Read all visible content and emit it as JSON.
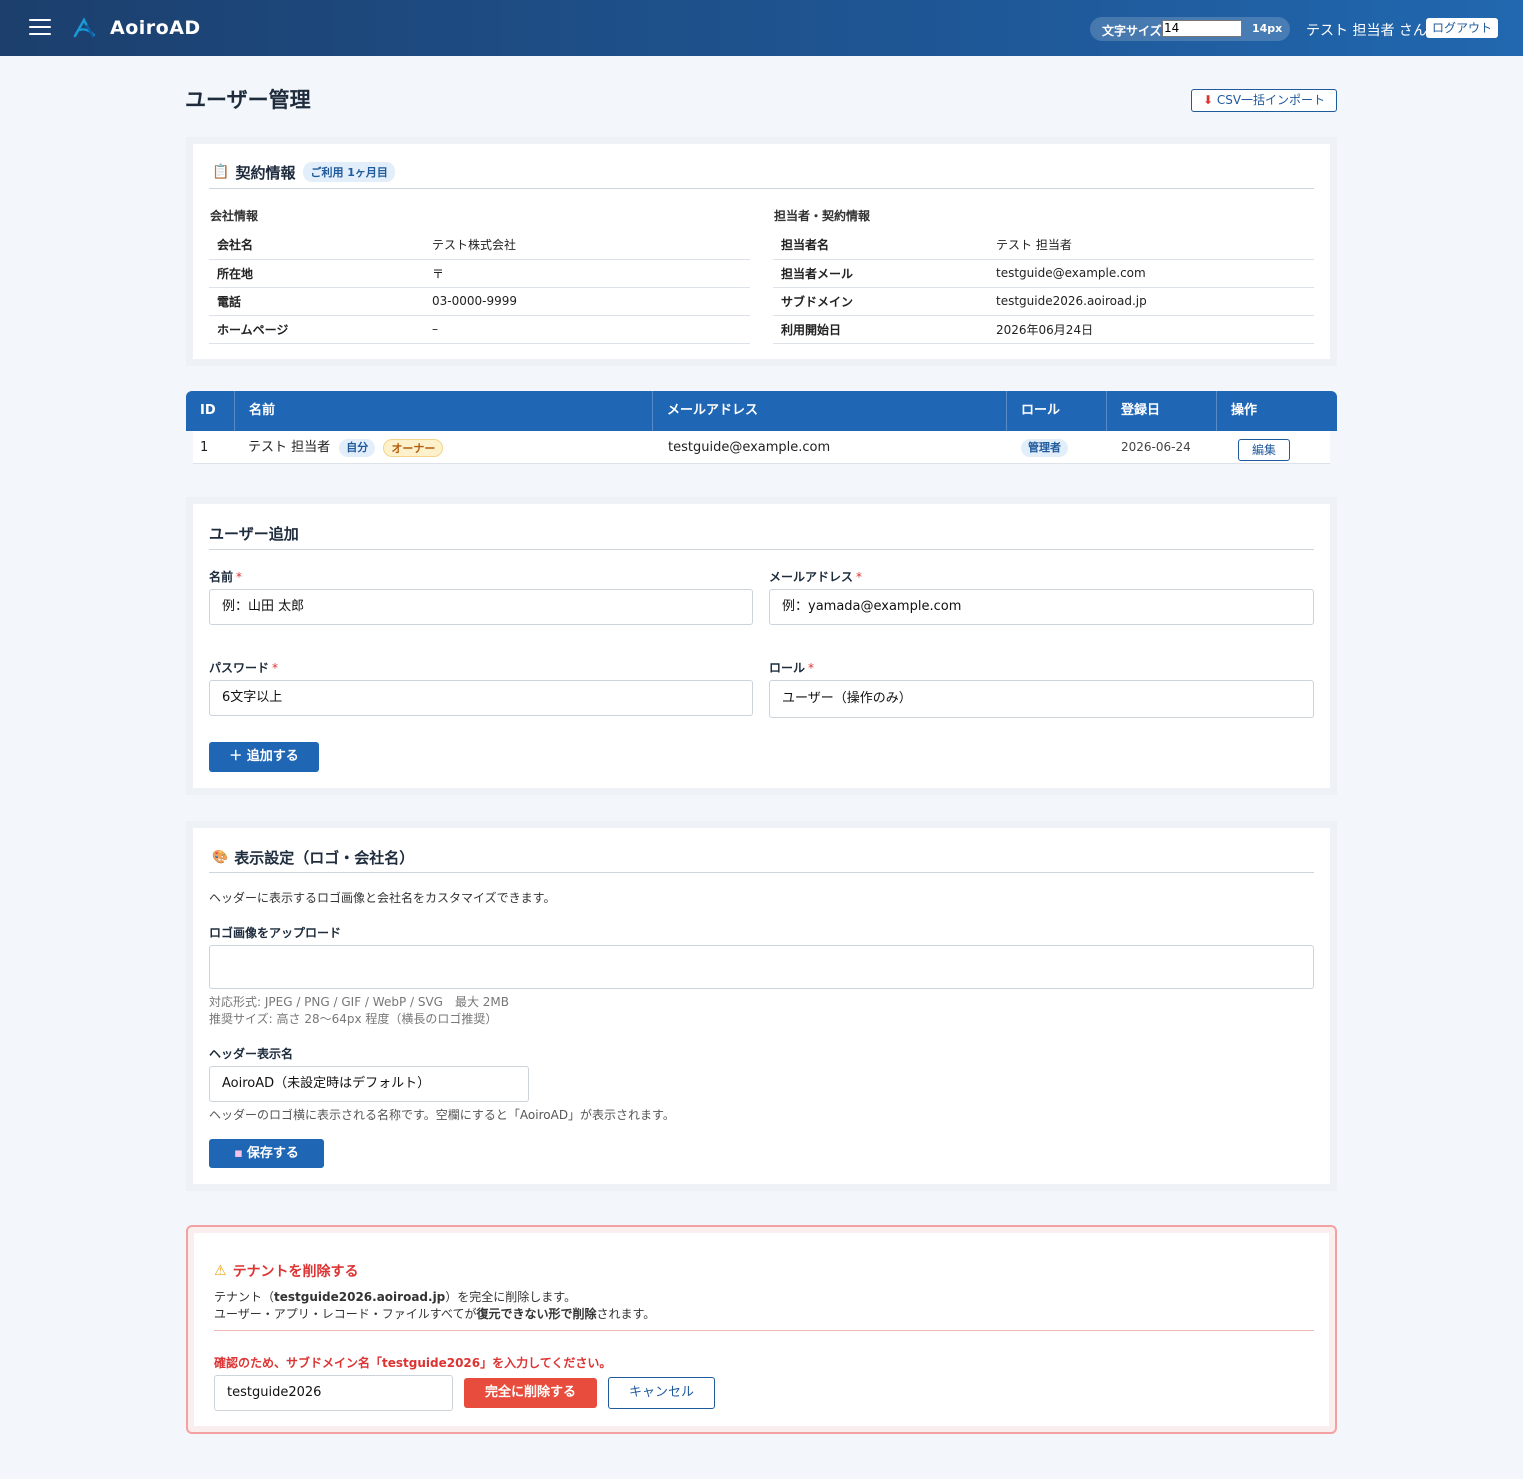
{
  "header": {
    "brand": "AoiroAD",
    "font_size_label": "文字サイズ",
    "font_size_input": "14",
    "font_size_value": "14px",
    "user_name": "テスト 担当者 さん",
    "logout": "ログアウト"
  },
  "page": {
    "title": "ユーザー管理",
    "csv_import": "CSV一括インポート"
  },
  "contract": {
    "title": "契約情報",
    "badge": "ご利用 1ヶ月目",
    "company_heading": "会社情報",
    "company": [
      {
        "key": "会社名",
        "value": "テスト株式会社"
      },
      {
        "key": "所在地",
        "value": "〒"
      },
      {
        "key": "電話",
        "value": "03-0000-9999"
      },
      {
        "key": "ホームページ",
        "value": "–"
      }
    ],
    "contact_heading": "担当者・契約情報",
    "contact": [
      {
        "key": "担当者名",
        "value": "テスト 担当者"
      },
      {
        "key": "担当者メール",
        "value": "testguide@example.com"
      },
      {
        "key": "サブドメイン",
        "value": "testguide2026.aoiroad.jp"
      },
      {
        "key": "利用開始日",
        "value": "2026年06月24日"
      }
    ]
  },
  "users_table": {
    "columns": [
      "ID",
      "名前",
      "メールアドレス",
      "ロール",
      "登録日",
      "操作"
    ],
    "rows": [
      {
        "id": "1",
        "name": "テスト 担当者",
        "self_badge": "自分",
        "owner_badge": "オーナー",
        "email": "testguide@example.com",
        "role": "管理者",
        "registered": "2026-06-24",
        "action": "編集"
      }
    ]
  },
  "add_user": {
    "title": "ユーザー追加",
    "name_label": "名前",
    "name_placeholder": "例：山田 太郎",
    "email_label": "メールアドレス",
    "email_placeholder": "例：yamada@example.com",
    "password_label": "パスワード",
    "password_placeholder": "6文字以上",
    "role_label": "ロール",
    "role_value": "ユーザー（操作のみ）",
    "required_mark": "*",
    "submit": "＋ 追加する"
  },
  "display": {
    "title": "表示設定（ロゴ・会社名）",
    "description": "ヘッダーに表示するロゴ画像と会社名をカスタマイズできます。",
    "logo_label": "ロゴ画像をアップロード",
    "formats": "対応形式: JPEG / PNG / GIF / WebP / SVG　最大 2MB",
    "recommended": "推奨サイズ: 高さ 28〜64px 程度（横長のロゴ推奨）",
    "header_name_label": "ヘッダー表示名",
    "header_name_placeholder": "AoiroAD（未設定時はデフォルト）",
    "header_name_help": "ヘッダーのロゴ横に表示される名称です。空欄にすると「AoiroAD」が表示されます。",
    "save": "保存する"
  },
  "danger": {
    "title": "テナントを削除する",
    "line1_prefix": "テナント（",
    "line1_domain": "testguide2026.aoiroad.jp",
    "line1_suffix": "）を完全に削除します。",
    "line2_prefix": "ユーザー・アプリ・レコード・ファイルすべてが",
    "line2_bold": "復元できない形で削除",
    "line2_suffix": "されます。",
    "confirm": "確認のため、サブドメイン名「testguide2026」を入力してください。",
    "input_value": "testguide2026",
    "delete": "完全に削除する",
    "cancel": "キャンセル"
  },
  "colors": {
    "header_start": "#1c3f6d",
    "header_end": "#2168b0",
    "primary": "#1f66b5",
    "danger": "#e74c3c"
  }
}
